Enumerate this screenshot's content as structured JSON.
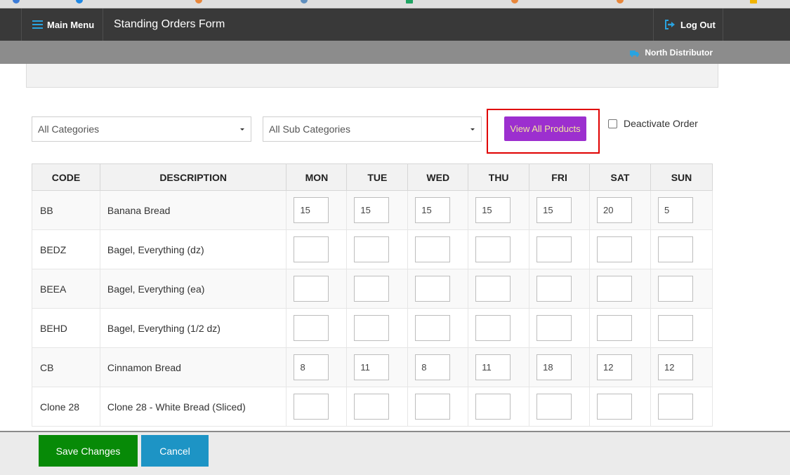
{
  "header": {
    "main_menu_label": "Main Menu",
    "page_title": "Standing Orders Form",
    "logout_label": "Log Out"
  },
  "subheader": {
    "distributor_name": "North Distributor"
  },
  "filters": {
    "category": "All Categories",
    "sub_category": "All Sub Categories",
    "view_all_label": "View All Products",
    "deactivate_label": "Deactivate Order",
    "deactivate_checked": false
  },
  "table": {
    "headers": {
      "code": "CODE",
      "description": "DESCRIPTION",
      "days": [
        "MON",
        "TUE",
        "WED",
        "THU",
        "FRI",
        "SAT",
        "SUN"
      ]
    },
    "rows": [
      {
        "code": "BB",
        "description": "Banana Bread",
        "qty": [
          "15",
          "15",
          "15",
          "15",
          "15",
          "20",
          "5"
        ]
      },
      {
        "code": "BEDZ",
        "description": "Bagel, Everything (dz)",
        "qty": [
          "",
          "",
          "",
          "",
          "",
          "",
          ""
        ]
      },
      {
        "code": "BEEA",
        "description": "Bagel, Everything (ea)",
        "qty": [
          "",
          "",
          "",
          "",
          "",
          "",
          ""
        ]
      },
      {
        "code": "BEHD",
        "description": "Bagel, Everything (1/2 dz)",
        "qty": [
          "",
          "",
          "",
          "",
          "",
          "",
          ""
        ]
      },
      {
        "code": "CB",
        "description": "Cinnamon Bread",
        "qty": [
          "8",
          "11",
          "8",
          "11",
          "18",
          "12",
          "12"
        ]
      },
      {
        "code": "Clone 28",
        "description": "Clone 28 - White Bread (Sliced)",
        "qty": [
          "",
          "",
          "",
          "",
          "",
          "",
          ""
        ]
      }
    ]
  },
  "footer": {
    "save_label": "Save Changes",
    "cancel_label": "Cancel"
  },
  "colors": {
    "topbar": "#393939",
    "accent_blue": "#29a3e0",
    "view_all_button": "#9c2fcf",
    "save_button": "#078a07",
    "cancel_button": "#1d94c5",
    "highlight": "#e00000"
  },
  "icons": {
    "menu": "hamburger-icon",
    "logout": "logout-icon",
    "distributor": "truck-icon",
    "dropdown": "caret-down-icon"
  }
}
